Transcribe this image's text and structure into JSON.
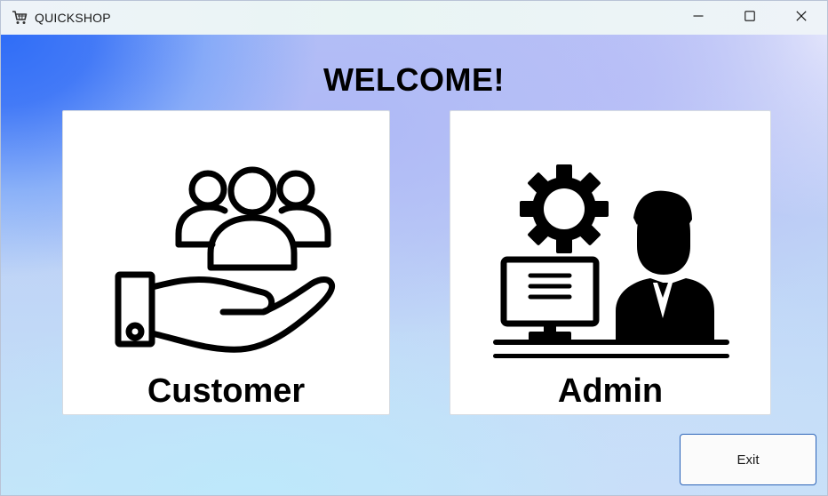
{
  "window": {
    "title": "QUICKSHOP",
    "app_icon": "shopping-cart-icon",
    "controls": {
      "minimize_icon": "minimize-icon",
      "maximize_icon": "maximize-icon",
      "close_icon": "close-icon"
    }
  },
  "main": {
    "heading": "WELCOME!",
    "cards": [
      {
        "label": "Customer",
        "icon": "customer-group-hand-icon"
      },
      {
        "label": "Admin",
        "icon": "admin-computer-gear-icon"
      }
    ],
    "exit_label": "Exit"
  },
  "colors": {
    "exit_border": "#2b63b8",
    "card_background": "#ffffff",
    "gradient_accent": "#2f6df7"
  }
}
